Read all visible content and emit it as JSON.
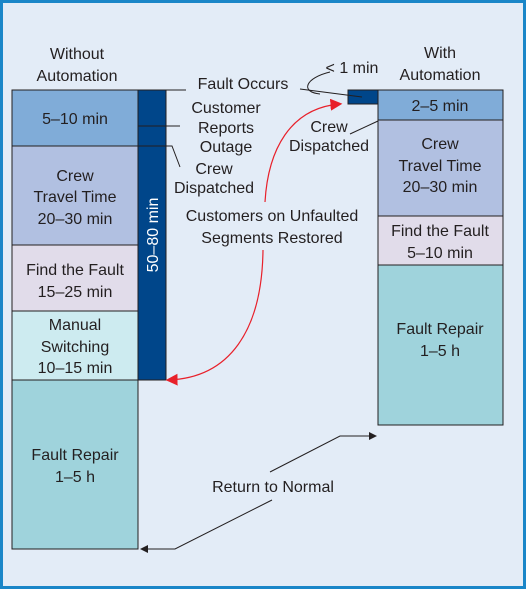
{
  "colors": {
    "frame": "#1a86c8",
    "background": "#e3ecf7",
    "notification": "#80acd8",
    "travel": "#b1c0e1",
    "find": "#e1dcea",
    "switching": "#cdebf0",
    "repair": "#9fd3dc",
    "restoration_bar": "#00468a",
    "arrow_red": "#e8202a"
  },
  "without": {
    "title": [
      "Without",
      "Automation"
    ],
    "stages": [
      {
        "lines": [
          "5–10 min"
        ]
      },
      {
        "lines": [
          "Crew",
          "Travel Time",
          "20–30 min"
        ]
      },
      {
        "lines": [
          "Find the Fault",
          "15–25 min"
        ]
      },
      {
        "lines": [
          "Manual",
          "Switching",
          "10–15 min"
        ]
      },
      {
        "lines": [
          "Fault Repair",
          "1–5 h"
        ]
      }
    ],
    "restoration_time": "50–80 min"
  },
  "with": {
    "title": [
      "With",
      "Automation"
    ],
    "stages": [
      {
        "lines": [
          "2–5 min"
        ]
      },
      {
        "lines": [
          "Crew",
          "Travel Time",
          "20–30 min"
        ]
      },
      {
        "lines": [
          "Find the Fault",
          "5–10 min"
        ]
      },
      {
        "lines": [
          "Fault Repair",
          "1–5 h"
        ]
      }
    ],
    "restoration_time": "< 1 min"
  },
  "events": {
    "fault_occurs": "Fault Occurs",
    "customer_reports": [
      "Customer",
      "Reports",
      "Outage"
    ],
    "crew_dispatched_left": [
      "Crew",
      "Dispatched"
    ],
    "crew_dispatched_right": [
      "Crew",
      "Dispatched"
    ],
    "restored": [
      "Customers on Unfaulted",
      "Segments Restored"
    ],
    "return_to_normal": "Return to Normal"
  }
}
